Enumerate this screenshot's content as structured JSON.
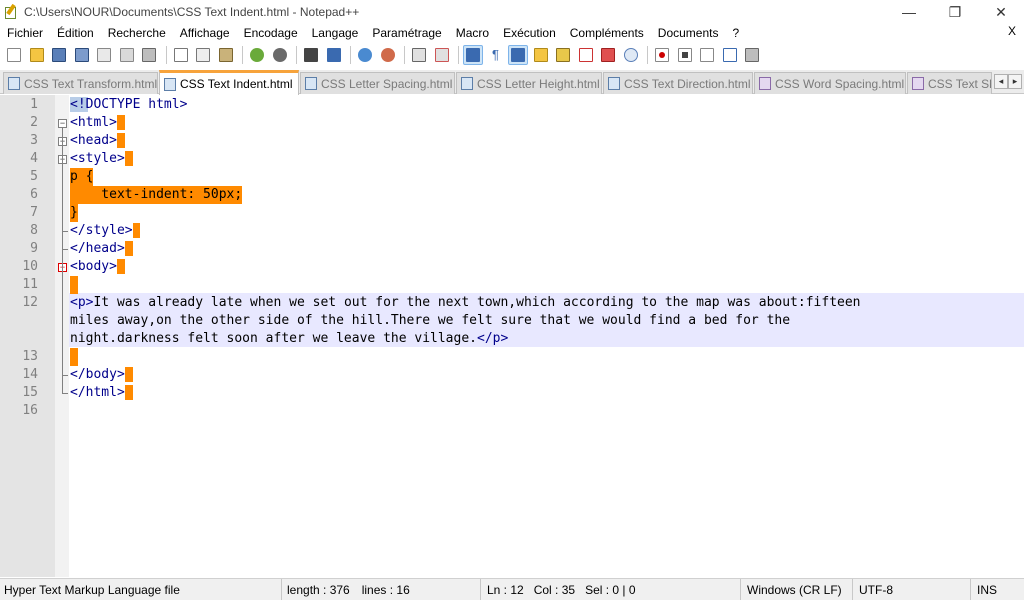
{
  "window": {
    "title": "C:\\Users\\NOUR\\Documents\\CSS Text Indent.html - Notepad++",
    "minimize": "—",
    "maximize": "❐",
    "close": "✕"
  },
  "menu": {
    "items": [
      "Fichier",
      "Édition",
      "Recherche",
      "Affichage",
      "Encodage",
      "Langage",
      "Paramétrage",
      "Macro",
      "Exécution",
      "Compléments",
      "Documents",
      "?"
    ],
    "close": "X"
  },
  "toolbar": {
    "buttons": [
      "new-file",
      "open-file",
      "save",
      "save-all",
      "close",
      "close-all",
      "print",
      "cut",
      "copy",
      "paste",
      "undo",
      "redo",
      "find",
      "replace",
      "zoom-in",
      "zoom-out",
      "sync-v",
      "sync-h",
      "word-wrap",
      "all-chars",
      "indent-guide",
      "udl",
      "doc-map",
      "func-list",
      "folder-workspace",
      "monitor",
      "record-macro",
      "stop-record",
      "play-macro",
      "run-multiple",
      "save-macro"
    ],
    "active": [
      "word-wrap",
      "indent-guide"
    ]
  },
  "tabs": [
    {
      "label": "CSS Text Transform.html",
      "active": false
    },
    {
      "label": "CSS Text Indent.html",
      "active": true
    },
    {
      "label": "CSS Letter Spacing.html",
      "active": false
    },
    {
      "label": "CSS Letter Height.html",
      "active": false
    },
    {
      "label": "CSS Text Direction.html",
      "active": false
    },
    {
      "label": "CSS Word Spacing.html",
      "active": false
    },
    {
      "label": "CSS Text Sha",
      "active": false
    }
  ],
  "tab_close": "×",
  "tab_arrows": {
    "left": "◂",
    "right": "▸"
  },
  "editor": {
    "line_numbers": [
      "1",
      "2",
      "3",
      "4",
      "5",
      "6",
      "7",
      "8",
      "9",
      "10",
      "11",
      "12",
      "13",
      "14",
      "15",
      "16"
    ],
    "lines": {
      "l1": "<!DOCTYPE html>",
      "l2": "<html>",
      "l3": "<head>",
      "l4": "<style>",
      "l5": "p {",
      "l6": "    text-indent: 50px;",
      "l7": "}",
      "l8": "</style>",
      "l9": "</head>",
      "l10": "<body>",
      "l11": " ",
      "l12a": "<p>",
      "l12b": "It was already late when we set out for the next town,which according to the map was about:fifteen",
      "l12c": "miles away,on the other side of the hill.There we felt sure that we would find a bed for the",
      "l12d": "night.darkness felt soon after we leave the village.",
      "l12e": "</p>",
      "l13": " ",
      "l14": "</body>",
      "l15": "</html>"
    }
  },
  "status": {
    "file_type": "Hyper Text Markup Language file",
    "length": "length : 376",
    "lines": "lines : 16",
    "ln": "Ln : 12",
    "col": "Col : 35",
    "sel": "Sel : 0 | 0",
    "eol": "Windows (CR LF)",
    "encoding": "UTF-8",
    "mode": "INS"
  },
  "colors": {
    "highlight": "#ff8a00",
    "current_line": "#e8e8ff",
    "tag": "#00008b",
    "active_tab_accent": "#f7a33b"
  }
}
